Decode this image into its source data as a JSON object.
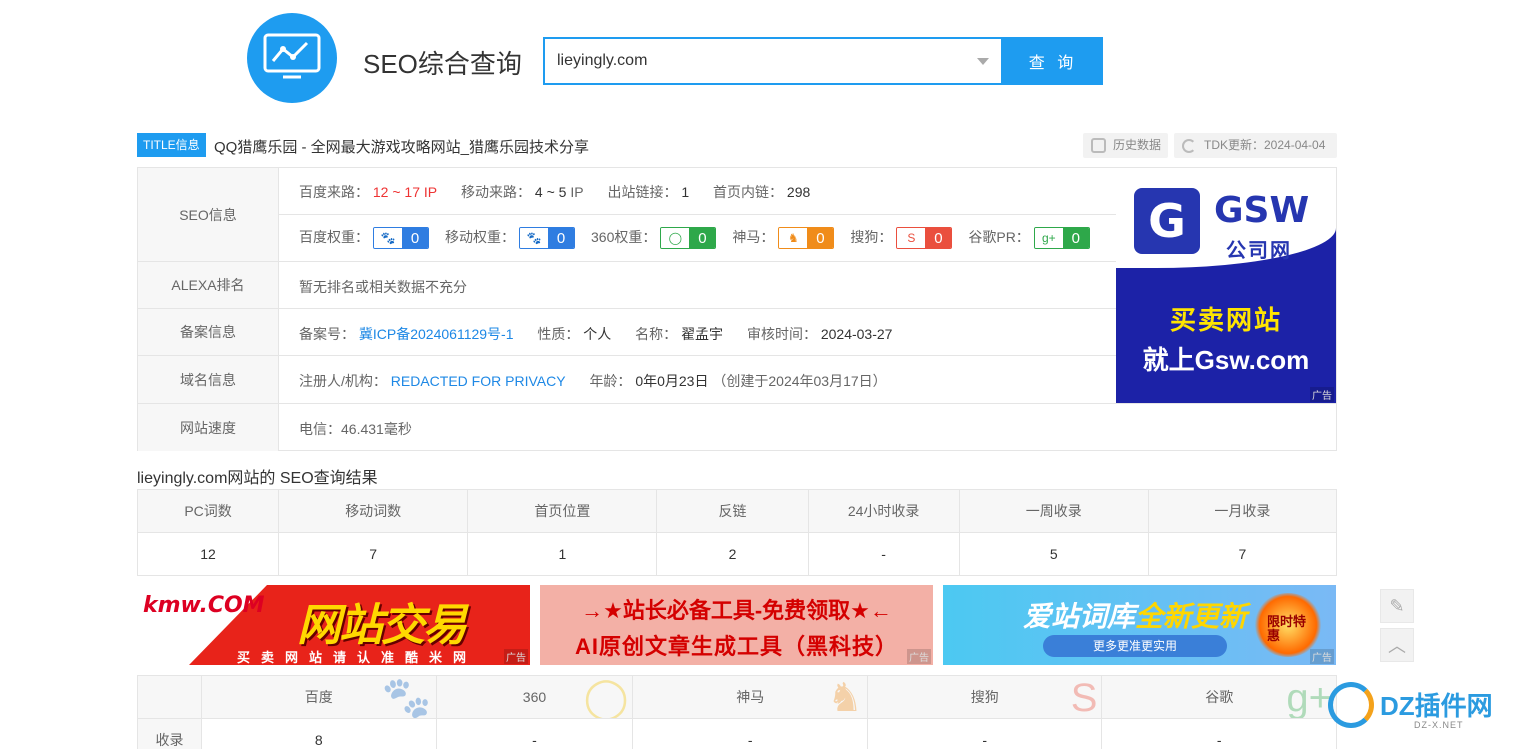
{
  "header": {
    "brand": "SEO综合查询",
    "search_value": "lieyingly.com",
    "search_button": "查 询"
  },
  "title_row": {
    "tag": "TITLE信息",
    "text": "QQ猎鹰乐园 - 全网最大游戏攻略网站_猎鹰乐园技术分享",
    "history": "历史数据",
    "tdk": "TDK更新：2024-04-04"
  },
  "seo_info": {
    "label": "SEO信息",
    "baidu_traffic_k": "百度来路：",
    "baidu_traffic_v": "12 ~ 17",
    "ip1": "IP",
    "mobile_traffic_k": "移动来路：",
    "mobile_traffic_v": "4 ~ 5",
    "ip2": "IP",
    "outlinks_k": "出站链接：",
    "outlinks_v": "1",
    "homelinks_k": "首页内链：",
    "homelinks_v": "298",
    "weights": [
      {
        "name": "百度权重：",
        "value": "0",
        "color": "#2f7de1",
        "icon": "paw-icon"
      },
      {
        "name": "移动权重：",
        "value": "0",
        "color": "#2f7de1",
        "icon": "paw-icon"
      },
      {
        "name": "360权重：",
        "value": "0",
        "color": "#2ea84a",
        "icon": "360-icon"
      },
      {
        "name": "神马：",
        "value": "0",
        "color": "#f08c1a",
        "icon": "shenma-icon"
      },
      {
        "name": "搜狗：",
        "value": "0",
        "color": "#ea4f3e",
        "icon": "sogou-icon"
      },
      {
        "name": "谷歌PR：",
        "value": "0",
        "color": "#2ea84a",
        "icon": "google-plus-icon"
      }
    ]
  },
  "alexa": {
    "label": "ALEXA排名",
    "text": "暂无排名或相关数据不充分"
  },
  "beian": {
    "label": "备案信息",
    "no_k": "备案号：",
    "no_v": "冀ICP备2024061129号-1",
    "type_k": "性质：",
    "type_v": "个人",
    "name_k": "名称：",
    "name_v": "翟孟宇",
    "date_k": "审核时间：",
    "date_v": "2024-03-27"
  },
  "domain": {
    "label": "域名信息",
    "reg_k": "注册人/机构：",
    "reg_v": "REDACTED FOR PRIVACY",
    "age_k": "年龄：",
    "age_v": "0年0月23日",
    "age_note": "（创建于2024年03月17日）"
  },
  "speed": {
    "label": "网站速度",
    "text": "电信：46.431毫秒"
  },
  "ad_gsw": {
    "brand": "GSW",
    "brand_cn": "公司网",
    "line1": "买卖网站",
    "line2": "就上Gsw.com",
    "tag": "广告"
  },
  "results": {
    "title": "lieyingly.com网站的 SEO查询结果",
    "headers": [
      "PC词数",
      "移动词数",
      "首页位置",
      "反链",
      "24小时收录",
      "一周收录",
      "一月收录"
    ],
    "values": [
      "12",
      "7",
      "1",
      "2",
      "-",
      "5",
      "7"
    ]
  },
  "banners": {
    "kmw_logo": "kmw.COM",
    "kmw_big": "网站交易",
    "kmw_small": "买卖网站请认准酷米网",
    "tool_line1": "→★站长必备工具-免费领取★←",
    "tool_line2": "AI原创文章生成工具（黑科技）",
    "aizhan_line": "爱站词库",
    "aizhan_hl": "全新更新",
    "aizhan_pill": "更多更准更实用",
    "aizhan_fire": "限时特惠",
    "ad_tag": "广告"
  },
  "engines": {
    "headers": [
      "",
      "百度",
      "360",
      "神马",
      "搜狗",
      "谷歌"
    ],
    "row_label": "收录",
    "values": [
      "8",
      "-",
      "-",
      "-",
      "-"
    ]
  },
  "watermark": {
    "text": "DZ插件网",
    "sub": "DZ-X.NET"
  }
}
